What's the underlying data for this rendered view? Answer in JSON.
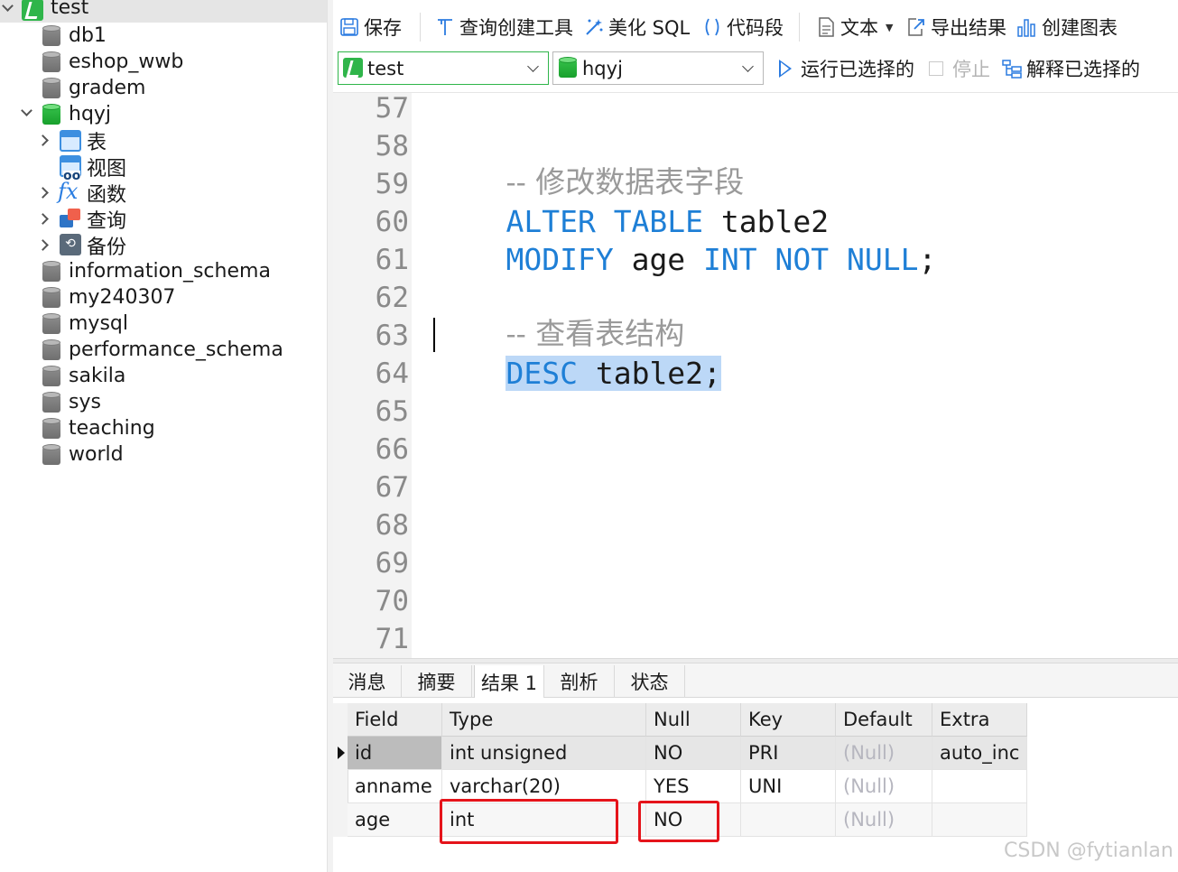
{
  "sidebar": {
    "connection": "test",
    "databases_top": [
      "db1",
      "eshop_wwb",
      "gradem"
    ],
    "open_db": "hqyj",
    "open_db_children": [
      "表",
      "视图",
      "函数",
      "查询",
      "备份"
    ],
    "databases_bottom": [
      "information_schema",
      "my240307",
      "mysql",
      "performance_schema",
      "sakila",
      "sys",
      "teaching",
      "world"
    ]
  },
  "toolbar": {
    "save": "保存",
    "query_builder": "查询创建工具",
    "beautify": "美化 SQL",
    "snippet": "代码段",
    "text": "文本",
    "export": "导出结果",
    "chart": "创建图表",
    "connection_combo": "test",
    "database_combo": "hqyj",
    "run_selected": "运行已选择的",
    "stop": "停止",
    "explain_selected": "解释已选择的"
  },
  "editor": {
    "line_numbers": [
      "57",
      "58",
      "59",
      "60",
      "61",
      "62",
      "63",
      "64",
      "65",
      "66",
      "67",
      "68",
      "69",
      "70",
      "71"
    ],
    "line58": {
      "comment": "-- 修改数据表字段"
    },
    "line59": {
      "kw1": "ALTER TABLE",
      "rest": " table2"
    },
    "line60": {
      "kw1": "MODIFY",
      "mid": " age ",
      "kw2": "INT NOT NULL",
      "rest": ";"
    },
    "line62": {
      "comment": "-- 查看表结构"
    },
    "line63": {
      "kw1": "DESC",
      "rest": " table2;"
    }
  },
  "result_tabs": [
    "消息",
    "摘要",
    "结果 1",
    "剖析",
    "状态"
  ],
  "result_active_tab": "结果 1",
  "result_grid": {
    "headers": [
      "Field",
      "Type",
      "Null",
      "Key",
      "Default",
      "Extra"
    ],
    "rows": [
      [
        "id",
        "int unsigned",
        "NO",
        "PRI",
        "(Null)",
        "auto_inc"
      ],
      [
        "anname",
        "varchar(20)",
        "YES",
        "UNI",
        "(Null)",
        ""
      ],
      [
        "age",
        "int",
        "NO",
        "",
        "(Null)",
        ""
      ]
    ]
  },
  "watermark": "CSDN @fytianlan",
  "colors": {
    "keyword": "#1e7fd6",
    "comment": "#9a9a9a",
    "selection": "#bcd8f7",
    "annotation_red": "#e5141b",
    "db_green": "#22aa36"
  }
}
